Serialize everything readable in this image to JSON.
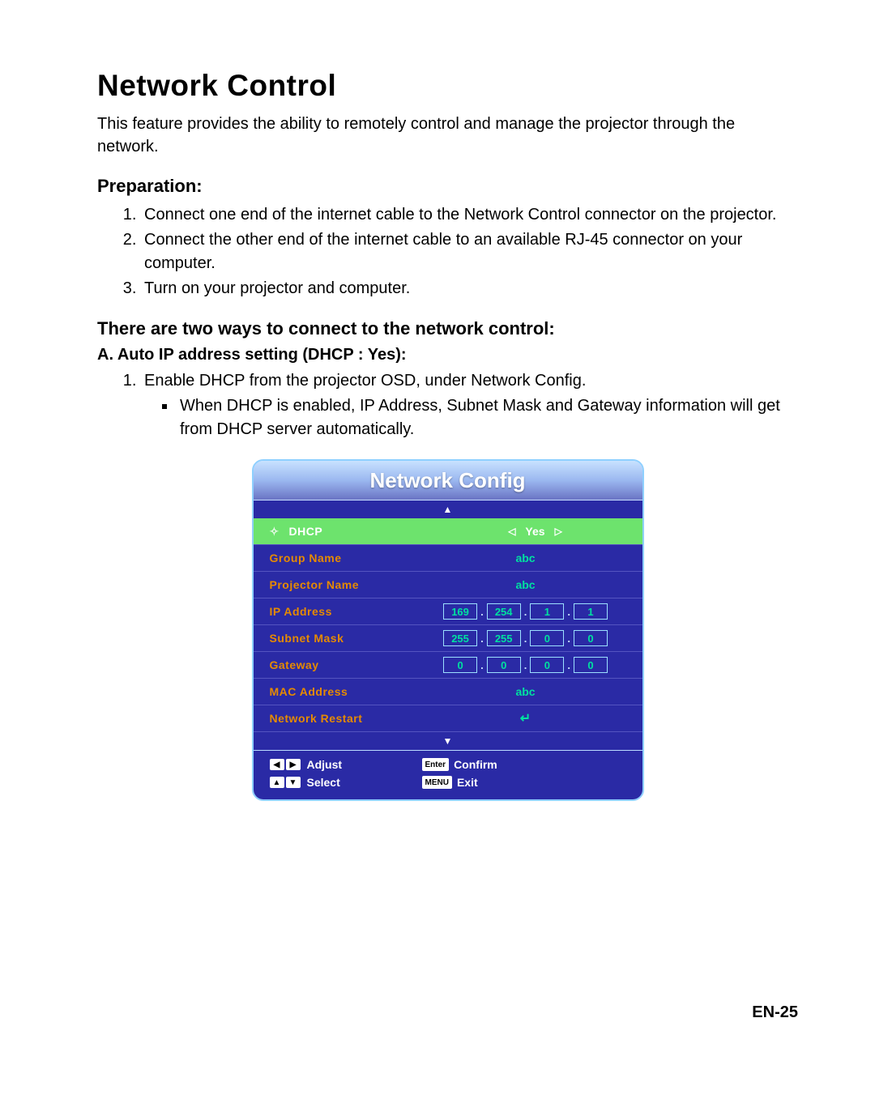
{
  "page": {
    "title": "Network Control",
    "intro": "This feature provides the ability to remotely control and manage the projector through the network.",
    "prep_heading": "Preparation:",
    "preparation": [
      "Connect one end of the internet cable to the Network Control connector on the projector.",
      "Connect the other end of the internet cable to an available RJ-45 connector on your computer.",
      "Turn on your projector and computer."
    ],
    "ways_heading": "There are two ways to connect to the network control:",
    "subA": "A. Auto IP address setting (DHCP : Yes):",
    "stepA1": "Enable DHCP from the projector OSD, under Network Config.",
    "stepA1_bullet": "When DHCP is enabled, IP Address, Subnet Mask and Gateway information will get from DHCP server automatically.",
    "pagenum": "EN-25"
  },
  "osd": {
    "title": "Network Config",
    "dhcp": {
      "label": "DHCP",
      "value": "Yes"
    },
    "group_name": {
      "label": "Group Name",
      "value": "abc"
    },
    "projector_name": {
      "label": "Projector Name",
      "value": "abc"
    },
    "ip_address": {
      "label": "IP Address",
      "octets": [
        "169",
        "254",
        "1",
        "1"
      ]
    },
    "subnet_mask": {
      "label": "Subnet Mask",
      "octets": [
        "255",
        "255",
        "0",
        "0"
      ]
    },
    "gateway": {
      "label": "Gateway",
      "octets": [
        "0",
        "0",
        "0",
        "0"
      ]
    },
    "mac_address": {
      "label": "MAC Address",
      "value": "abc"
    },
    "network_restart": {
      "label": "Network Restart"
    },
    "footer": {
      "adjust": "Adjust",
      "select": "Select",
      "enter_key": "Enter",
      "confirm": "Confirm",
      "menu_key": "MENU",
      "exit": "Exit"
    }
  }
}
